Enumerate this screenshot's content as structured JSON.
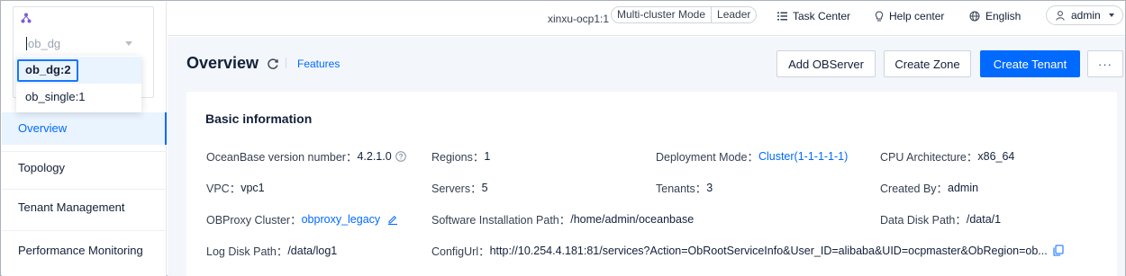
{
  "sidebar": {
    "cluster_selector": {
      "value": "ob_dg"
    },
    "cluster_options": [
      {
        "label": "ob_dg:2",
        "selected": true
      },
      {
        "label": "ob_single:1",
        "selected": false
      }
    ],
    "nav_items": [
      {
        "label": "Overview",
        "active": true
      },
      {
        "label": "Topology",
        "active": false
      },
      {
        "label": "Tenant Management",
        "active": false
      },
      {
        "label": "Performance Monitoring",
        "active": false
      }
    ]
  },
  "header": {
    "cluster_name": "xinxu-ocp1:1",
    "mode": "Multi-cluster Mode",
    "role": "Leader",
    "task_center": "Task Center",
    "help_center": "Help center",
    "language": "English",
    "user": "admin"
  },
  "page": {
    "title": "Overview",
    "features_link": "Features",
    "buttons": {
      "add_observer": "Add OBServer",
      "create_zone": "Create Zone",
      "create_tenant": "Create Tenant",
      "more": "···"
    }
  },
  "basic_info": {
    "title": "Basic information",
    "version": {
      "label": "OceanBase version number：",
      "value": "4.2.1.0"
    },
    "regions": {
      "label": "Regions：",
      "value": "1"
    },
    "deployment_mode": {
      "label": "Deployment Mode：",
      "value": "Cluster(1-1-1-1-1)"
    },
    "cpu_arch": {
      "label": "CPU Architecture：",
      "value": "x86_64"
    },
    "vpc": {
      "label": "VPC：",
      "value": "vpc1"
    },
    "servers": {
      "label": "Servers：",
      "value": "5"
    },
    "tenants": {
      "label": "Tenants：",
      "value": "3"
    },
    "created_by": {
      "label": "Created By：",
      "value": "admin"
    },
    "obproxy_cluster": {
      "label": "OBProxy Cluster：",
      "value": "obproxy_legacy"
    },
    "install_path": {
      "label": "Software Installation Path：",
      "value": "/home/admin/oceanbase"
    },
    "data_disk_path": {
      "label": "Data Disk Path：",
      "value": "/data/1"
    },
    "log_disk_path": {
      "label": "Log Disk Path：",
      "value": "/data/log1"
    },
    "config_url": {
      "label": "ConfigUrl：",
      "value": "http://10.254.4.181:81/services?Action=ObRootServiceInfo&User_ID=alibaba&UID=ocpmaster&ObRegion=ob..."
    }
  },
  "colors": {
    "accent": "#006aff",
    "highlight_box": "#1677ff",
    "active_bg": "#eaf4ff",
    "main_bg": "#f3f6fa"
  }
}
